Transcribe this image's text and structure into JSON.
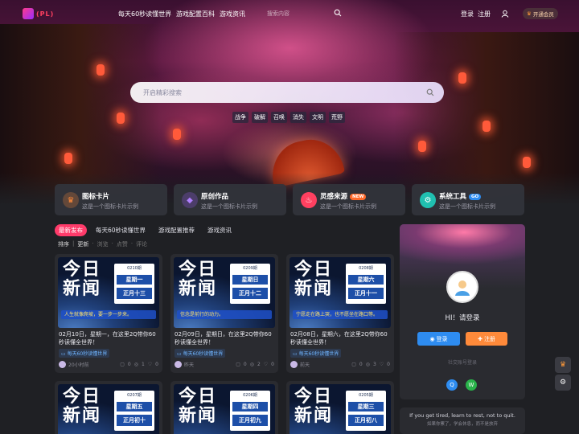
{
  "nav": {
    "logo_text": "(PL)",
    "links": [
      "每天60秒读懂世界",
      "游戏配置百科",
      "游戏资讯"
    ],
    "search_placeholder": "搜索内容",
    "login": "登录",
    "register": "注册",
    "vip": "开通会员"
  },
  "hero": {
    "search_placeholder": "开启精彩搜索",
    "tags": [
      "战争",
      "破解",
      "召唤",
      "消失",
      "文明",
      "荒野"
    ]
  },
  "features": [
    {
      "title": "图标卡片",
      "subtitle": "这是一个图标卡片示例",
      "badge": "",
      "color": "#ff8a3a",
      "icon": "crown-icon"
    },
    {
      "title": "原创作品",
      "subtitle": "这是一个图标卡片示例",
      "badge": "",
      "color": "#a060ff",
      "icon": "diamond-icon"
    },
    {
      "title": "灵感来源",
      "subtitle": "这是一个图标卡片示例",
      "badge": "NEW",
      "badge_color": "#ff6a2a",
      "color": "#ff4060",
      "icon": "flame-icon"
    },
    {
      "title": "系统工具",
      "subtitle": "这是一个图标卡片示例",
      "badge": "GO",
      "badge_color": "#2e8cf0",
      "color": "#20c0b0",
      "icon": "tool-icon"
    }
  ],
  "tabs": [
    "最新发布",
    "每天60秒读懂世界",
    "游戏配置推荐",
    "游戏资讯"
  ],
  "sort": {
    "label": "排序",
    "options": [
      "更新",
      "浏览",
      "点赞",
      "评论"
    ]
  },
  "posts": [
    {
      "jr": "今日\n新闻",
      "number": "0210期",
      "weekday": "星期一",
      "lunar": "正月十三",
      "banner": "人生就像爬坡，要一步一步来。",
      "title": "02月10日，星期一，在这里2Q带你60秒读懂全世界！",
      "category": "每天60秒读懂世界",
      "time": "20小时前",
      "comments": "0",
      "views": "1",
      "likes": "0"
    },
    {
      "jr": "今日\n新闻",
      "number": "0209期",
      "weekday": "星期日",
      "lunar": "正月十二",
      "banner": "信念是前行的动力。",
      "title": "02月09日，星期日，在这里2Q带你60秒读懂全世界！",
      "category": "每天60秒读懂世界",
      "time": "昨天",
      "comments": "0",
      "views": "2",
      "likes": "0"
    },
    {
      "jr": "今日\n新闻",
      "number": "0208期",
      "weekday": "星期六",
      "lunar": "正月十一",
      "banner": "宁愿走在路上哭，也不愿坐在路口等。",
      "title": "02月08日，星期六，在这里2Q带你60秒读懂全世界！",
      "category": "每天60秒读懂世界",
      "time": "前天",
      "comments": "0",
      "views": "3",
      "likes": "0"
    },
    {
      "jr": "今日\n新闻",
      "number": "0207期",
      "weekday": "星期五",
      "lunar": "正月初十"
    },
    {
      "jr": "今日\n新闻",
      "number": "0206期",
      "weekday": "星期四",
      "lunar": "正月初九"
    },
    {
      "jr": "今日\n新闻",
      "number": "0205期",
      "weekday": "星期三",
      "lunar": "正月初八"
    }
  ],
  "sidebar": {
    "greeting": "HI！请登录",
    "login": "登录",
    "register": "注册",
    "social_label": "社交账号登录"
  },
  "quote": {
    "en": "If you get tired, learn to rest, not to quit.",
    "cn": "如果你累了，学会休息，而不是放弃"
  }
}
